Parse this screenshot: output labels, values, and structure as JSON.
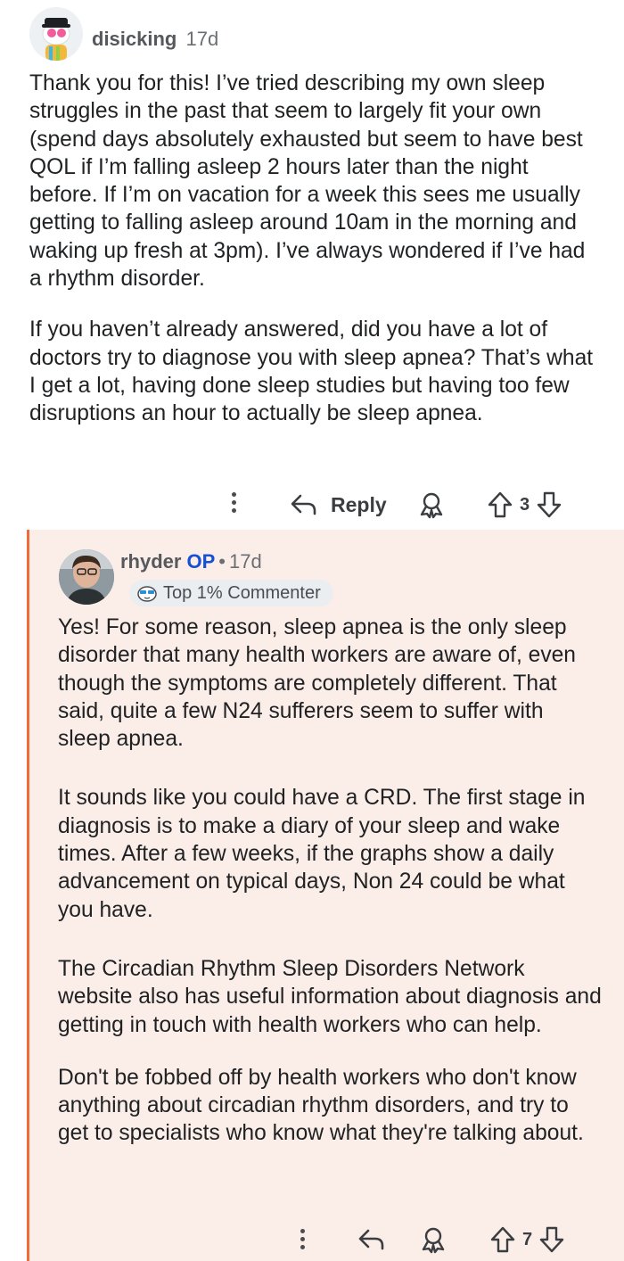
{
  "comment": {
    "username": "disicking",
    "age": "17d",
    "paragraphs": [
      "Thank you for this! I’ve tried describing my own sleep struggles in the past that seem to largely fit your own (spend days absolutely exhausted but seem to have best QOL if I’m falling asleep 2 hours later than the night before. If I’m on vacation for a week this sees me usually getting to falling asleep around 10am in the morning and waking up fresh at 3pm). I’ve always wondered if I’ve had a rhythm disorder.",
      "If you haven’t already answered, did you have a lot of doctors try to diagnose you with sleep apnea? That’s what I get a lot, having done sleep studies but having too few disruptions an hour to actually be sleep apnea."
    ],
    "reply_label": "Reply",
    "vote_count": "3"
  },
  "reply": {
    "username": "rhyder",
    "op_label": "OP",
    "separator": "•",
    "age": "17d",
    "badge_label": "Top 1% Commenter",
    "paragraphs": [
      "Yes! For some reason, sleep apnea is the only sleep disorder that many health workers are aware of, even though the symptoms are completely different. That said, quite a few N24 sufferers seem to suffer with sleep apnea.",
      "It sounds like you could have a CRD. The first stage in diagnosis is to make a diary of your sleep and wake times. After a few weeks, if the graphs show a daily advancement on typical days, Non 24 could be what you have.",
      "The Circadian Rhythm Sleep Disorders Network website also has useful information about diagnosis and getting in touch with health workers who can help.",
      "Don't be fobbed off by health workers who don't know anything about circadian rhythm disorders, and try to get to specialists who know what they're talking about."
    ],
    "vote_count": "7"
  },
  "colors": {
    "reply_bg": "#fbede8",
    "thread_line": "#f06a3a",
    "op_blue": "#1750d0"
  }
}
